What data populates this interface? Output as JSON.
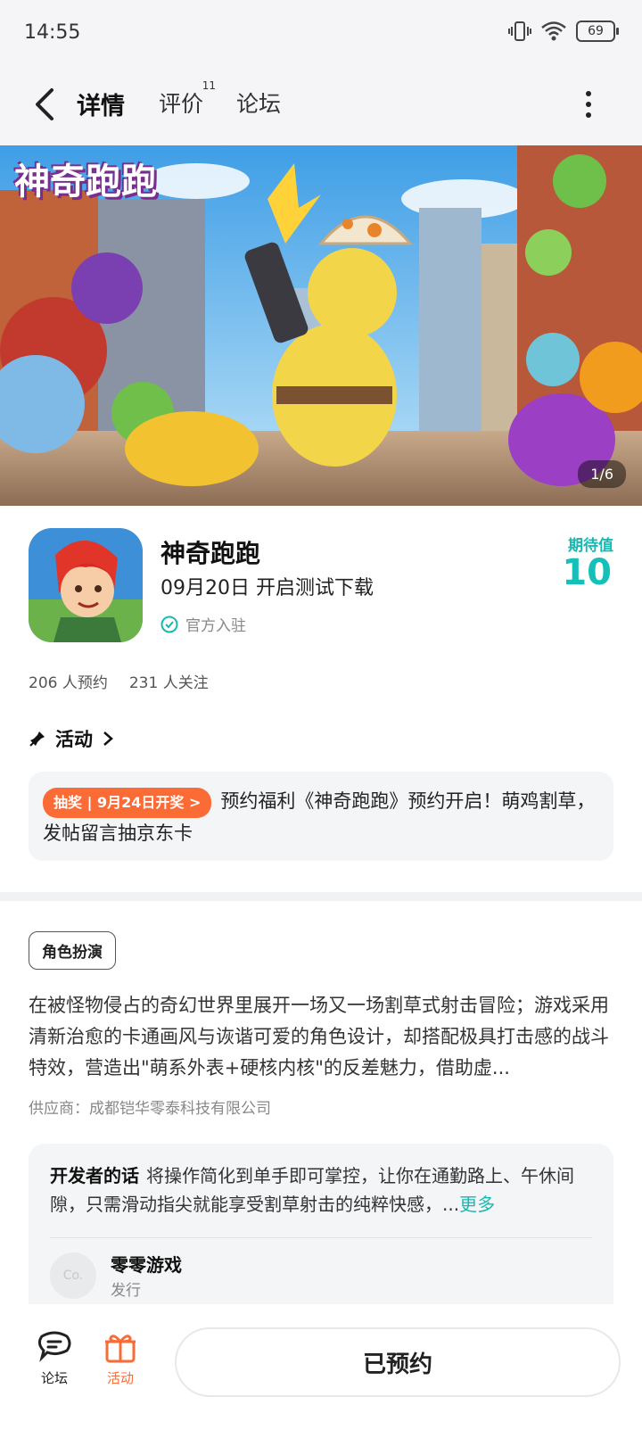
{
  "status_bar": {
    "time": "14:55",
    "battery": "69"
  },
  "nav": {
    "tabs": [
      {
        "label": "详情",
        "badge": ""
      },
      {
        "label": "评价",
        "badge": "11"
      },
      {
        "label": "论坛",
        "badge": ""
      }
    ]
  },
  "banner": {
    "title": "神奇跑跑",
    "counter": "1/6"
  },
  "app": {
    "name": "神奇跑跑",
    "release": "09月20日 开启测试下载",
    "verified": "官方入驻",
    "expect_label": "期待值",
    "expect_value": "10",
    "reservations": "206 人预约",
    "followers": "231 人关注"
  },
  "activity": {
    "header": "活动",
    "badge": "抽奖 | 9月24日开奖 >",
    "text": "预约福利《神奇跑跑》预约开启！萌鸡割草，发帖留言抽京东卡"
  },
  "detail": {
    "tag": "角色扮演",
    "description": "在被怪物侵占的奇幻世界里展开一场又一场割草式射击冒险；游戏采用清新治愈的卡通画风与诙谐可爱的角色设计，却搭配极具打击感的战斗特效，营造出\"萌系外表+硬核内核\"的反差魅力，借助虚...",
    "supplier": "供应商：成都铠华零泰科技有限公司"
  },
  "developer": {
    "label": "开发者的话",
    "text": "将操作简化到单手即可掌控，让你在通勤路上、午休间隙，只需滑动指尖就能享受割草射击的纯粹快感，...",
    "more": "更多",
    "avatar_text": "Co.",
    "publisher_name": "零零游戏",
    "publisher_role": "发行"
  },
  "bottom_bar": {
    "forum_label": "论坛",
    "activity_label": "活动",
    "reserved_label": "已预约"
  },
  "colors": {
    "accent": "#14c0b8",
    "orange": "#fa6b35"
  }
}
